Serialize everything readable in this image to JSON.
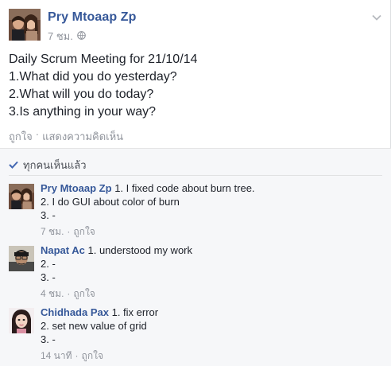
{
  "post": {
    "author": "Pry Mtoaap Zp",
    "time": "7 ชม.",
    "lines": [
      "Daily Scrum Meeting for 21/10/14",
      "1.What did you do yesterday?",
      "2.What will you do today?",
      "3.Is anything in your way?"
    ],
    "like_label": "ถูกใจ",
    "separator": "·",
    "comment_label": "แสดงความคิดเห็น"
  },
  "seen": {
    "label": "ทุกคนเห็นแล้ว"
  },
  "comments": [
    {
      "name": "Pry Mtoaap Zp",
      "first_line": "1. I fixed code about burn tree.",
      "lines": [
        "2. I do GUI about color of burn",
        "3. -"
      ],
      "time": "7 ชม.",
      "separator": "·",
      "like_label": "ถูกใจ"
    },
    {
      "name": "Napat Ac",
      "first_line": "1. understood my work",
      "lines": [
        "2. -",
        "3. -"
      ],
      "time": "4 ชม.",
      "separator": "·",
      "like_label": "ถูกใจ"
    },
    {
      "name": "Chidhada Pax",
      "first_line": "1. fix error",
      "lines": [
        "2. set new value of grid",
        "3. -"
      ],
      "time": "14 นาที",
      "separator": "·",
      "like_label": "ถูกใจ"
    }
  ],
  "colors": {
    "name_link": "#365899",
    "meta_gray": "#90949c",
    "ufi_bg": "#f6f7f9",
    "checkmark": "#4267b2"
  },
  "icons": [
    "chevron-down-icon",
    "globe-icon",
    "checkmark-icon"
  ]
}
